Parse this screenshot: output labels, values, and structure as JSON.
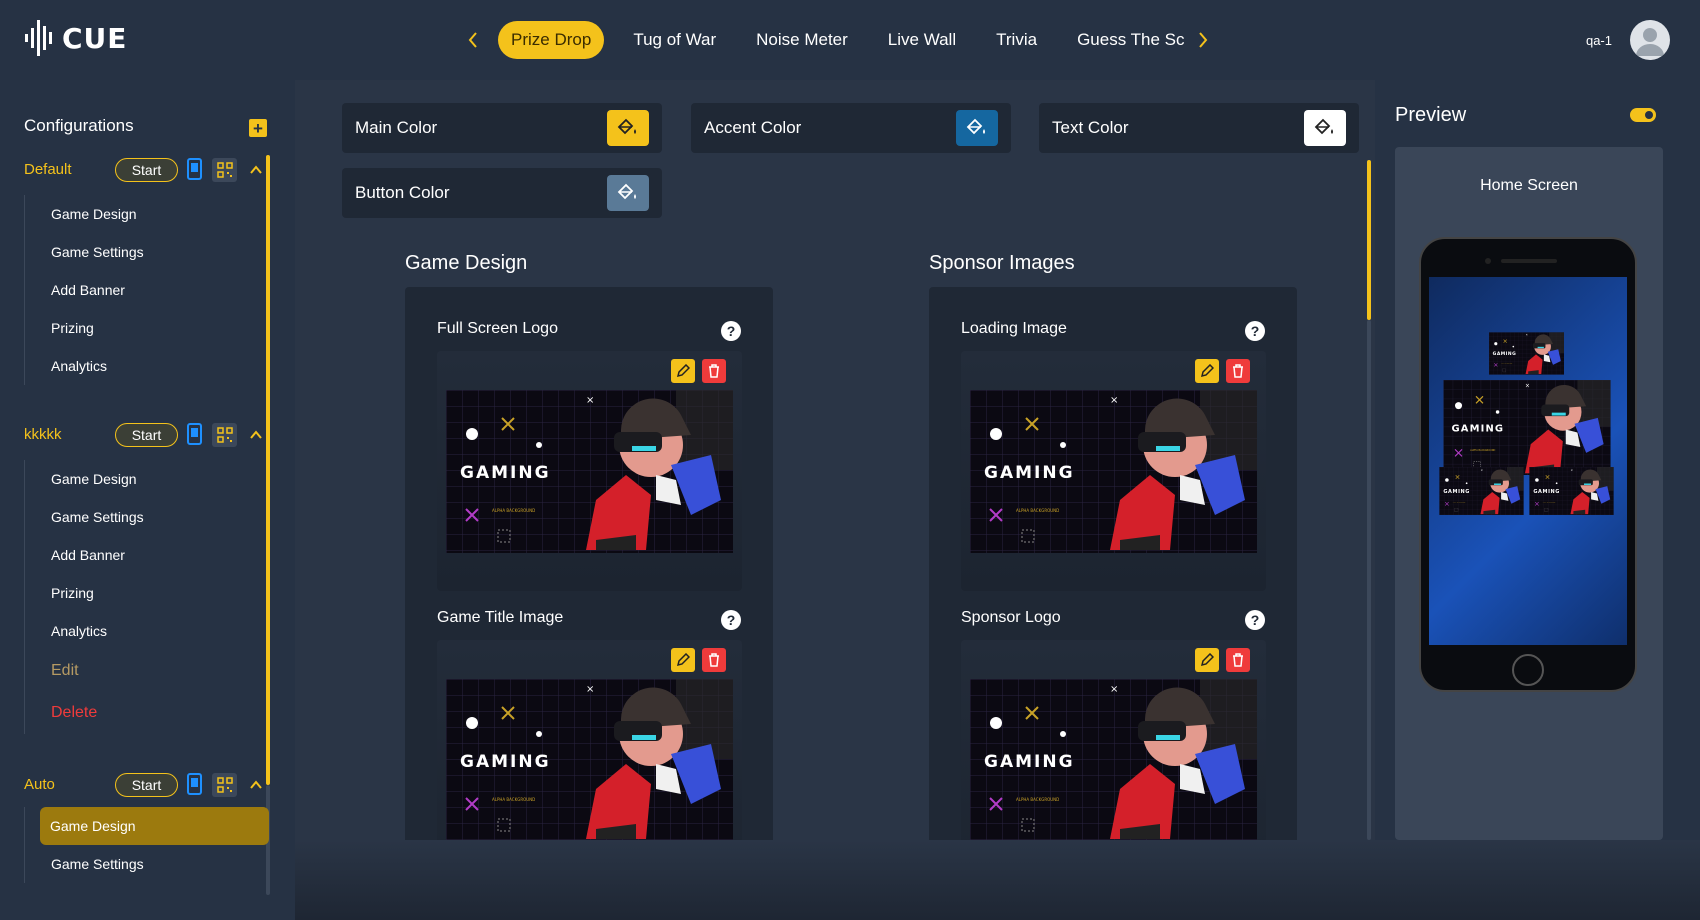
{
  "app": {
    "logo_text": "CUE"
  },
  "tabs": [
    {
      "label": "Prize Drop",
      "active": true
    },
    {
      "label": "Tug of War"
    },
    {
      "label": "Noise Meter"
    },
    {
      "label": "Live Wall"
    },
    {
      "label": "Trivia"
    },
    {
      "label": "Guess The Sc"
    }
  ],
  "user": {
    "name": "qa-1"
  },
  "sidebar": {
    "title": "Configurations",
    "configs": [
      {
        "name": "Default",
        "start_label": "Start",
        "items": [
          "Game Design",
          "Game Settings",
          "Add Banner",
          "Prizing",
          "Analytics"
        ]
      },
      {
        "name": "kkkkk",
        "start_label": "Start",
        "items": [
          "Game Design",
          "Game Settings",
          "Add Banner",
          "Prizing",
          "Analytics"
        ],
        "edit_label": "Edit",
        "delete_label": "Delete"
      },
      {
        "name": "Auto",
        "start_label": "Start",
        "items": [
          "Game Design",
          "Game Settings"
        ],
        "active_item": "Game Design"
      }
    ]
  },
  "colors": {
    "main_color": {
      "label": "Main Color",
      "value": "#f4c21b"
    },
    "accent_color": {
      "label": "Accent Color",
      "value": "#1567a0"
    },
    "text_color": {
      "label": "Text Color",
      "value": "#ffffff"
    },
    "button_color": {
      "label": "Button Color",
      "value": "#5a7a97"
    }
  },
  "game_design": {
    "title": "Game Design",
    "slots": [
      {
        "label": "Full Screen Logo",
        "help": "?"
      },
      {
        "label": "Game Title Image",
        "help": "?"
      }
    ]
  },
  "sponsor_images": {
    "title": "Sponsor Images",
    "slots": [
      {
        "label": "Loading Image",
        "help": "?"
      },
      {
        "label": "Sponsor Logo",
        "help": "?"
      }
    ]
  },
  "thumbnail": {
    "text": "GAMING"
  },
  "preview": {
    "title": "Preview",
    "screen_label": "Home Screen"
  },
  "theme": {
    "accent": "#f4c21b",
    "danger": "#ef3b3b",
    "background": "#263244"
  }
}
